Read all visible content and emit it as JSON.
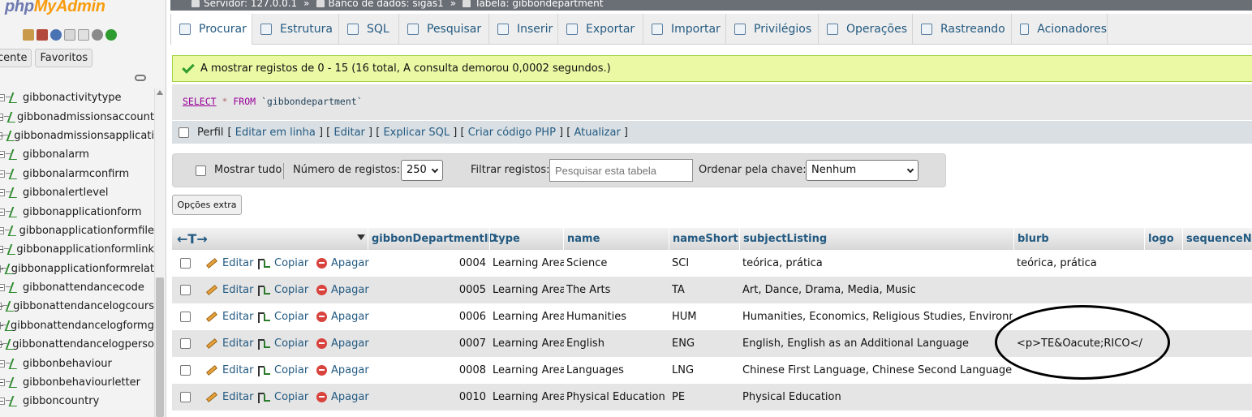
{
  "nav": {
    "logo_php": "php",
    "logo_myadmin": "MyAdmin",
    "tab_recent": "cente",
    "tab_favorites": "Favoritos",
    "tables": [
      "gibbonactivitytype",
      "gibbonadmissionsaccount",
      "gibbonadmissionsapplicati",
      "gibbonalarm",
      "gibbonalarmconfirm",
      "gibbonalertlevel",
      "gibbonapplicationform",
      "gibbonapplicationformfile",
      "gibbonapplicationformlink",
      "gibbonapplicationformrelat",
      "gibbonattendancecode",
      "gibbonattendancelogcours",
      "gibbonattendancelogformg",
      "gibbonattendancelogperso",
      "gibbonbehaviour",
      "gibbonbehaviourletter",
      "gibboncountry"
    ]
  },
  "breadcrumb": {
    "server": "Servidor: 127.0.0.1",
    "database": "Banco de dados: sigas1",
    "table": "Tabela: gibbondepartment",
    "sep": "»"
  },
  "tabs": [
    "Procurar",
    "Estrutura",
    "SQL",
    "Pesquisar",
    "Inserir",
    "Exportar",
    "Importar",
    "Privilégios",
    "Operações",
    "Rastreando",
    "Acionadores"
  ],
  "message": "A mostrar registos de 0 - 15 (16 total, A consulta demorou 0,0002 segundos.)",
  "sql": {
    "select": "SELECT",
    "star": "*",
    "from": "FROM",
    "table": "`gibbondepartment`"
  },
  "profile": {
    "label": "Perfil",
    "links": [
      "Editar em linha",
      "Editar",
      "Explicar SQL",
      "Criar código PHP",
      "Atualizar"
    ]
  },
  "filters": {
    "show_all": "Mostrar tudo",
    "num_label": "Número de registos:",
    "num_value": "250",
    "filter_label": "Filtrar registos:",
    "filter_placeholder": "Pesquisar esta tabela",
    "order_label": "Ordenar pela chave:",
    "order_value": "Nenhum"
  },
  "extra_options": "Opções extra",
  "table": {
    "columns": [
      "gibbonDepartmentID",
      "type",
      "name",
      "nameShort",
      "subjectListing",
      "blurb",
      "logo",
      "sequenceNumb"
    ],
    "actions": {
      "edit": "Editar",
      "copy": "Copiar",
      "delete": "Apagar"
    },
    "rows": [
      {
        "id": "0004",
        "type": "Learning Area",
        "name": "Science",
        "short": "SCI",
        "subject": "teórica, prática",
        "blurb": "teórica, prática"
      },
      {
        "id": "0005",
        "type": "Learning Area",
        "name": "The Arts",
        "short": "TA",
        "subject": "Art, Dance, Drama, Media, Music",
        "blurb": ""
      },
      {
        "id": "0006",
        "type": "Learning Area",
        "name": "Humanities",
        "short": "HUM",
        "subject": "Humanities, Economics, Religious Studies, Environm...",
        "blurb": ""
      },
      {
        "id": "0007",
        "type": "Learning Area",
        "name": "English",
        "short": "ENG",
        "subject": "English, English as an Additional Language",
        "blurb": "<p>TE&Oacute;RICO</p>"
      },
      {
        "id": "0008",
        "type": "Learning Area",
        "name": "Languages",
        "short": "LNG",
        "subject": "Chinese First Language, Chinese Second Language, J...",
        "blurb": ""
      },
      {
        "id": "0010",
        "type": "Learning Area",
        "name": "Physical Education",
        "short": "PE",
        "subject": "Physical Education",
        "blurb": ""
      }
    ]
  }
}
